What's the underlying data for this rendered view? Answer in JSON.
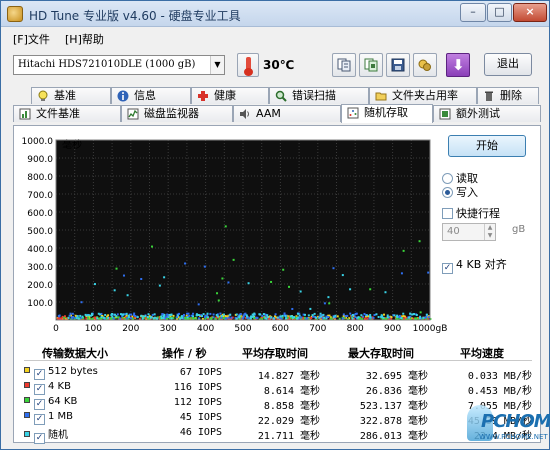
{
  "window": {
    "title": "HD Tune 专业版 v4.60 - 硬盘专业工具",
    "min_glyph": "–",
    "max_glyph": "□",
    "close_glyph": "×"
  },
  "menu": [
    {
      "label": "[F]文件"
    },
    {
      "label": "[H]帮助"
    }
  ],
  "toolbar": {
    "drive": "Hitachi HDS721010DLE   (1000 gB)",
    "drive_arrow": "▼",
    "temperature": "30℃",
    "exit_label": "退出",
    "icons": [
      "copy-info-icon",
      "copy-screenshot-icon",
      "save-icon",
      "options-icon",
      "download-icon"
    ]
  },
  "tabs": {
    "row1": [
      {
        "label": "基准",
        "icon": "lightbulb-icon"
      },
      {
        "label": "信息",
        "icon": "info-icon"
      },
      {
        "label": "健康",
        "icon": "health-icon"
      },
      {
        "label": "错误扫描",
        "icon": "magnifier-icon"
      },
      {
        "label": "文件夹占用率",
        "icon": "folder-icon"
      },
      {
        "label": "删除",
        "icon": "trash-icon"
      }
    ],
    "row2": [
      {
        "label": "文件基准",
        "icon": "file-benchmark-icon"
      },
      {
        "label": "磁盘监视器",
        "icon": "disk-monitor-icon"
      },
      {
        "label": "AAM",
        "icon": "speaker-icon"
      },
      {
        "label": "随机存取",
        "icon": "random-access-icon",
        "active": true
      },
      {
        "label": "额外测试",
        "icon": "extra-tests-icon"
      }
    ]
  },
  "controls": {
    "start_label": "开始",
    "read_label": "读取",
    "write_label": "写入",
    "selected_mode": "write",
    "fast_travel_label": "快捷行程",
    "fast_travel_checked": false,
    "fast_travel_value": "40",
    "fast_travel_unit": "gB",
    "align_label": "4 KB 对齐",
    "align_checked": true
  },
  "chart_data": {
    "type": "scatter",
    "ylabel": "毫秒",
    "ylim": [
      0,
      1000
    ],
    "yticks": [
      "1000.0",
      "900.0",
      "800.0",
      "700.0",
      "600.0",
      "500.0",
      "400.0",
      "300.0",
      "200.0",
      "100.0"
    ],
    "xlim": [
      0,
      1000
    ],
    "xticks": [
      "0",
      "100",
      "200",
      "300",
      "400",
      "500",
      "600",
      "700",
      "800",
      "900",
      "1000gB"
    ],
    "grid": true,
    "background": "#0f0f0f",
    "series": [
      {
        "color": "#f4d21f",
        "mean_ms": 14.827,
        "max_ms": 32.695
      },
      {
        "color": "#ef3a2f",
        "mean_ms": 8.614,
        "max_ms": 26.836
      },
      {
        "color": "#3ad43a",
        "mean_ms": 8.858,
        "max_ms": 523.137
      },
      {
        "color": "#2f6ff0",
        "mean_ms": 22.029,
        "max_ms": 322.878
      },
      {
        "color": "#39d3e6",
        "mean_ms": 21.711,
        "max_ms": 286.013
      }
    ]
  },
  "results": {
    "headers": [
      "传输数据大小",
      "操作 / 秒",
      "平均存取时间",
      "最大存取时间",
      "平均速度"
    ],
    "rows": [
      {
        "color": "#f4d21f",
        "size": "512 bytes",
        "ops": "67 IOPS",
        "avg": "14.827 毫秒",
        "max": "32.695 毫秒",
        "speed": "0.033 MB/秒"
      },
      {
        "color": "#ef3a2f",
        "size": "4 KB",
        "ops": "116 IOPS",
        "avg": "8.614 毫秒",
        "max": "26.836 毫秒",
        "speed": "0.453 MB/秒"
      },
      {
        "color": "#3ad43a",
        "size": "64 KB",
        "ops": "112 IOPS",
        "avg": "8.858 毫秒",
        "max": "523.137 毫秒",
        "speed": "7.055 MB/秒"
      },
      {
        "color": "#2f6ff0",
        "size": "1 MB",
        "ops": "45 IOPS",
        "avg": "22.029 毫秒",
        "max": "322.878 毫秒",
        "speed": "45.39 MB/秒"
      },
      {
        "color": "#39d3e6",
        "size": "随机",
        "ops": "46 IOPS",
        "avg": "21.711 毫秒",
        "max": "286.013 毫秒",
        "speed": "23.4 MB/秒"
      }
    ]
  },
  "watermark": {
    "brand": "PCHOME",
    "url": "WWW.PCHOME.NET"
  }
}
